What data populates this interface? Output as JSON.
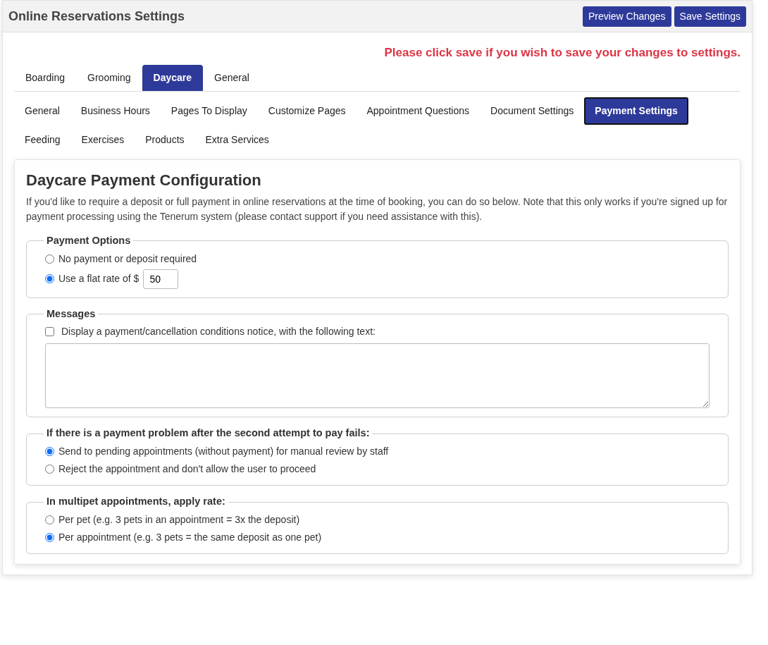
{
  "header": {
    "title": "Online Reservations Settings",
    "buttons": [
      "Preview Changes",
      "Save Settings"
    ]
  },
  "notice": "Please click save if you wish to save your changes to settings.",
  "tabs": [
    {
      "label": "Boarding",
      "selected": false
    },
    {
      "label": "Grooming",
      "selected": false
    },
    {
      "label": "Daycare",
      "selected": true
    },
    {
      "label": "General",
      "selected": false
    }
  ],
  "subtabs": [
    {
      "label": "General",
      "selected": false
    },
    {
      "label": "Business Hours",
      "selected": false
    },
    {
      "label": "Pages To Display",
      "selected": false
    },
    {
      "label": "Customize Pages",
      "selected": false
    },
    {
      "label": "Appointment Questions",
      "selected": false
    },
    {
      "label": "Document Settings",
      "selected": false
    },
    {
      "label": "Payment Settings",
      "selected": true
    },
    {
      "label": "Feeding",
      "selected": false
    },
    {
      "label": "Exercises",
      "selected": false
    },
    {
      "label": "Products",
      "selected": false
    },
    {
      "label": "Extra Services",
      "selected": false
    }
  ],
  "section": {
    "title": "Daycare Payment Configuration",
    "description": "If you'd like to require a deposit or full payment in online reservations at the time of booking, you can do so below. Note that this only works if you're signed up for payment processing using the Tenerum system (please contact support if you need assistance with this)."
  },
  "groups": [
    {
      "legend": "Payment Options",
      "items": [
        {
          "kind": "radio",
          "label": "No payment or deposit required",
          "checked": false
        },
        {
          "kind": "radio",
          "label": "Use a flat rate of $",
          "checked": true,
          "value": "50"
        }
      ]
    },
    {
      "legend": "Messages",
      "items": [
        {
          "kind": "checkbox",
          "label": "Display a payment/cancellation conditions notice, with the following text:",
          "checked": false
        },
        {
          "kind": "textarea"
        }
      ]
    },
    {
      "legend": "If there is a payment problem after the second attempt to pay fails:",
      "items": [
        {
          "kind": "radio",
          "label": "Send to pending appointments (without payment) for manual review by staff",
          "checked": true
        },
        {
          "kind": "radio",
          "label": "Reject the appointment and don't allow the user to proceed",
          "checked": false
        }
      ]
    },
    {
      "legend": "In multipet appointments, apply rate:",
      "items": [
        {
          "kind": "radio",
          "label": "Per pet (e.g. 3 pets in an appointment = 3x the deposit)",
          "checked": false
        },
        {
          "kind": "radio",
          "label": "Per appointment (e.g. 3 pets = the same deposit as one pet)",
          "checked": true
        }
      ]
    }
  ]
}
